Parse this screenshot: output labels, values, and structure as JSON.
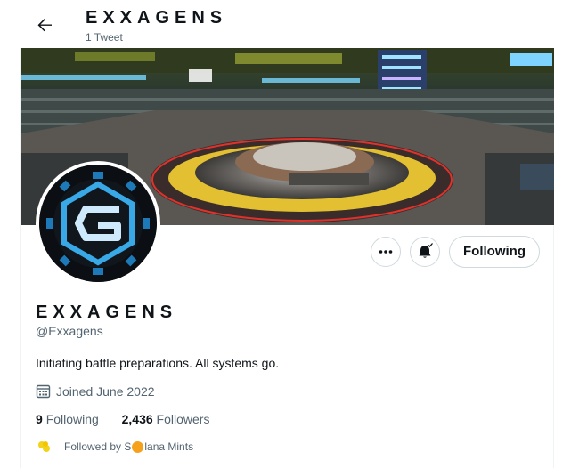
{
  "header": {
    "title": "EXXAGENS",
    "tweet_count": "1 Tweet"
  },
  "profile": {
    "display_name": "EXXAGENS",
    "handle": "@Exxagens",
    "bio": "Initiating battle preparations. All systems go.",
    "joined": "Joined June 2022",
    "following_count": "9",
    "following_label": "Following",
    "followers_count": "2,436",
    "followers_label": "Followers",
    "followed_by_prefix": "Followed by S",
    "followed_by_suffix": "lana Mints"
  },
  "actions": {
    "more_icon": "more-horizontal-icon",
    "notify_icon": "bell-check-icon",
    "follow_label": "Following"
  },
  "colors": {
    "text_primary": "#0f1419",
    "text_secondary": "#536471",
    "border": "#cfd9de",
    "accent_logo": "#39a8e6",
    "badge_orange": "#f5a11b"
  }
}
